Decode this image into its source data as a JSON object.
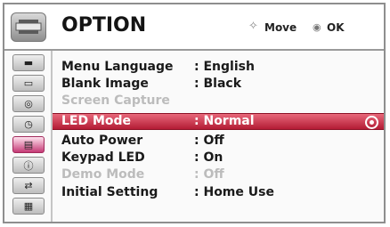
{
  "header": {
    "title": "OPTION",
    "move_icon": "✧",
    "move_label": "Move",
    "ok_icon": "◉",
    "ok_label": "OK"
  },
  "sidebar": {
    "items": [
      {
        "name": "picture-icon",
        "glyph": "▬"
      },
      {
        "name": "screen-icon",
        "glyph": "▭"
      },
      {
        "name": "audio-icon",
        "glyph": "◎"
      },
      {
        "name": "timer-icon",
        "glyph": "◷"
      },
      {
        "name": "option-icon",
        "glyph": "▤",
        "active": true
      },
      {
        "name": "info-icon",
        "glyph": "ⓘ"
      },
      {
        "name": "input-icon",
        "glyph": "⇄"
      },
      {
        "name": "media-icon",
        "glyph": "▦"
      }
    ]
  },
  "menu": {
    "items": [
      {
        "label": "Menu Language",
        "value": ": English",
        "state": "normal"
      },
      {
        "label": "Blank Image",
        "value": ": Black",
        "state": "normal"
      },
      {
        "label": "Screen Capture",
        "value": "",
        "state": "disabled"
      },
      {
        "label": "LED Mode",
        "value": ": Normal",
        "state": "selected"
      },
      {
        "label": "Auto Power",
        "value": ": Off",
        "state": "normal"
      },
      {
        "label": "Keypad LED",
        "value": ": On",
        "state": "normal"
      },
      {
        "label": "Demo Mode",
        "value": ": Off",
        "state": "disabled"
      },
      {
        "label": "Initial Setting",
        "value": ": Home Use",
        "state": "normal"
      }
    ]
  },
  "colors": {
    "selected_row": "#c4263f",
    "active_tab": "#c43a75",
    "disabled_text": "#bcbcbc"
  }
}
